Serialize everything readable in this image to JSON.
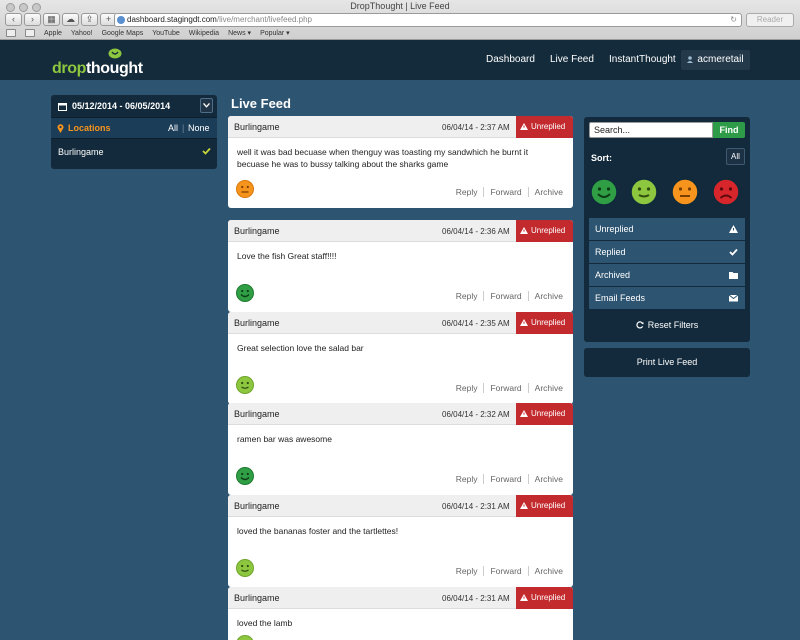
{
  "browser": {
    "window_title": "DropThought | Live Feed",
    "url_host": "dashboard.stagingdt.com",
    "url_path": "/live/merchant/livefeed.php",
    "reader_label": "Reader",
    "bookmarks": [
      "Apple",
      "Yahoo!",
      "Google Maps",
      "YouTube",
      "Wikipedia",
      "News ▾",
      "Popular ▾"
    ]
  },
  "header": {
    "logo_part1": "drop",
    "logo_part2": "thought",
    "nav": [
      "Dashboard",
      "Live Feed",
      "InstantThought"
    ],
    "user": "acmeretail"
  },
  "left_panel": {
    "date_range": "05/12/2014 - 06/05/2014",
    "locations_label": "Locations",
    "all_label": "All",
    "none_label": "None",
    "location_item": "Burlingame"
  },
  "feed": {
    "title": "Live Feed",
    "actions": [
      "Reply",
      "Forward",
      "Archive"
    ],
    "cards": [
      {
        "location": "Burlingame",
        "time": "06/04/14 - 2:37 AM",
        "status": "Unreplied",
        "text": "well it was bad becuase when thenguy was toasting my sandwhich he burnt it becuase he was to bussy talking about the sharks game",
        "sentiment": "orange-face-icon"
      },
      {
        "location": "Burlingame",
        "time": "06/04/14 - 2:36 AM",
        "status": "Unreplied",
        "text": "Love the fish Great staff!!!!",
        "sentiment": "dark-green-face-icon"
      },
      {
        "location": "Burlingame",
        "time": "06/04/14 - 2:35 AM",
        "status": "Unreplied",
        "text": "Great selection love the salad bar",
        "sentiment": "light-green-face-icon"
      },
      {
        "location": "Burlingame",
        "time": "06/04/14 - 2:32 AM",
        "status": "Unreplied",
        "text": "ramen bar was awesome",
        "sentiment": "dark-green-face-icon"
      },
      {
        "location": "Burlingame",
        "time": "06/04/14 - 2:31 AM",
        "status": "Unreplied",
        "text": "loved the bananas foster and the tartlettes!",
        "sentiment": "light-green-face-icon"
      },
      {
        "location": "Burlingame",
        "time": "06/04/14 - 2:31 AM",
        "status": "Unreplied",
        "text": "loved the lamb",
        "sentiment": "light-green-face-icon"
      }
    ]
  },
  "right_panel": {
    "search_placeholder": "Search...",
    "find_label": "Find",
    "sort_label": "Sort:",
    "sort_all": "All",
    "filters": [
      {
        "label": "Unreplied",
        "icon": "warning-icon"
      },
      {
        "label": "Replied",
        "icon": "checkmark-icon"
      },
      {
        "label": "Archived",
        "icon": "folder-icon"
      },
      {
        "label": "Email Feeds",
        "icon": "envelope-icon"
      }
    ],
    "reset_label": "Reset Filters",
    "print_label": "Print Live Feed"
  },
  "colors": {
    "page_bg": "#2d5470",
    "header_bg": "#142b3b",
    "panel_bg": "#122a3b",
    "badge_red": "#c32a2e",
    "find_green": "#2e9b48",
    "locations_orange": "#f7941d",
    "logo_green": "#8dc63f"
  }
}
